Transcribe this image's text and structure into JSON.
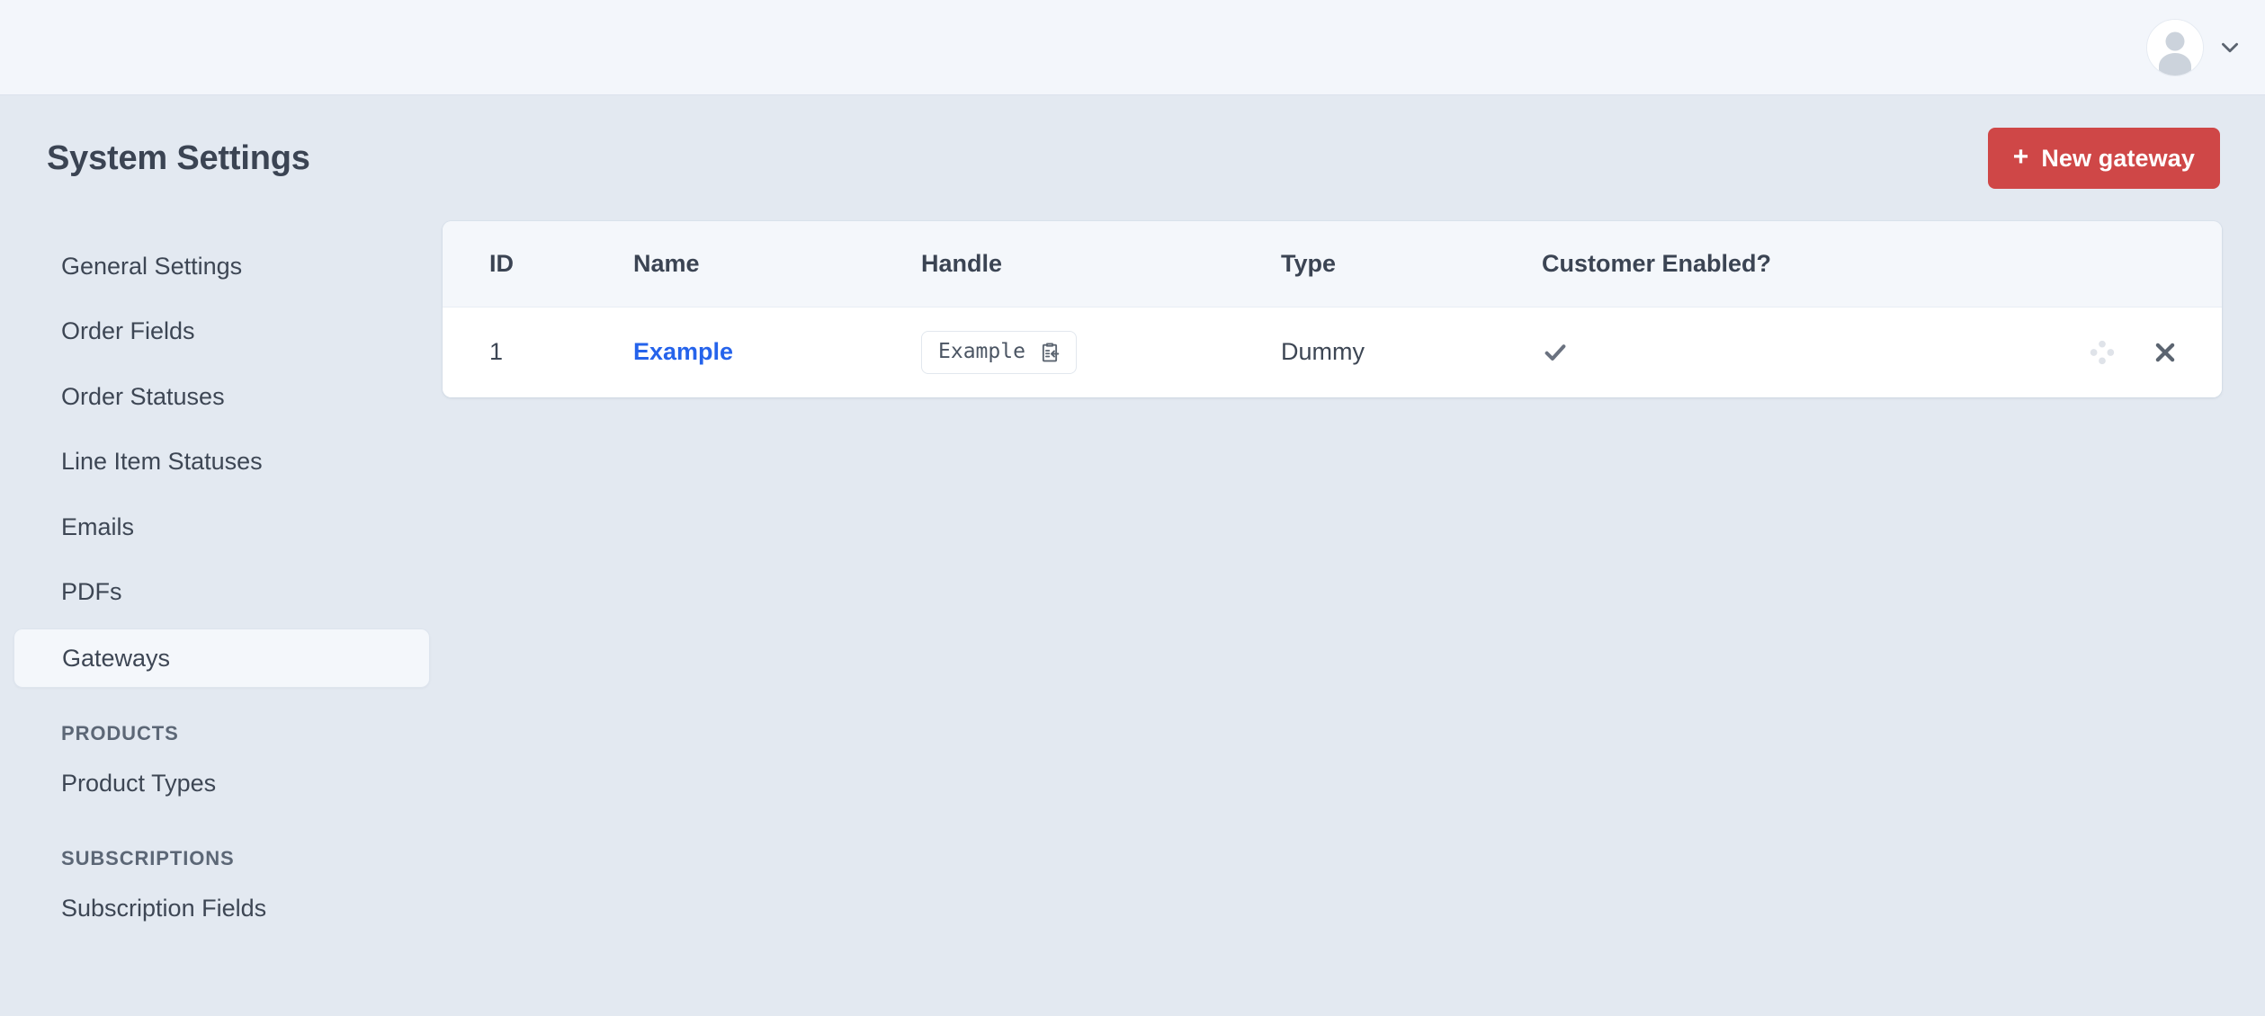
{
  "topbar": {
    "avatar_icon": "user-avatar-icon",
    "dropdown_icon": "chevron-down-icon"
  },
  "page": {
    "title": "System Settings",
    "new_button": {
      "label": "New gateway",
      "icon": "plus-icon",
      "color": "#cf4747"
    }
  },
  "sidebar": {
    "items": [
      {
        "label": "General Settings",
        "active": false
      },
      {
        "label": "Order Fields",
        "active": false
      },
      {
        "label": "Order Statuses",
        "active": false
      },
      {
        "label": "Line Item Statuses",
        "active": false
      },
      {
        "label": "Emails",
        "active": false
      },
      {
        "label": "PDFs",
        "active": false
      },
      {
        "label": "Gateways",
        "active": true
      }
    ],
    "sections": [
      {
        "heading": "PRODUCTS",
        "items": [
          {
            "label": "Product Types",
            "active": false
          }
        ]
      },
      {
        "heading": "SUBSCRIPTIONS",
        "items": [
          {
            "label": "Subscription Fields",
            "active": false
          }
        ]
      }
    ]
  },
  "table": {
    "columns": [
      "ID",
      "Name",
      "Handle",
      "Type",
      "Customer Enabled?"
    ],
    "rows": [
      {
        "id": "1",
        "name": "Example",
        "handle": "Example",
        "handle_copy_icon": "clipboard-copy-icon",
        "type": "Dummy",
        "customer_enabled": true,
        "customer_enabled_icon": "check-icon",
        "drag_icon": "drag-handle-icon",
        "delete_icon": "close-icon"
      }
    ]
  },
  "colors": {
    "accent_link": "#2563eb",
    "danger": "#cf4747",
    "page_bg": "#e3e9f1",
    "topbar_bg": "#f3f6fb",
    "card_bg": "#ffffff",
    "table_head_bg": "#f4f7fb",
    "text": "#3d4654"
  }
}
